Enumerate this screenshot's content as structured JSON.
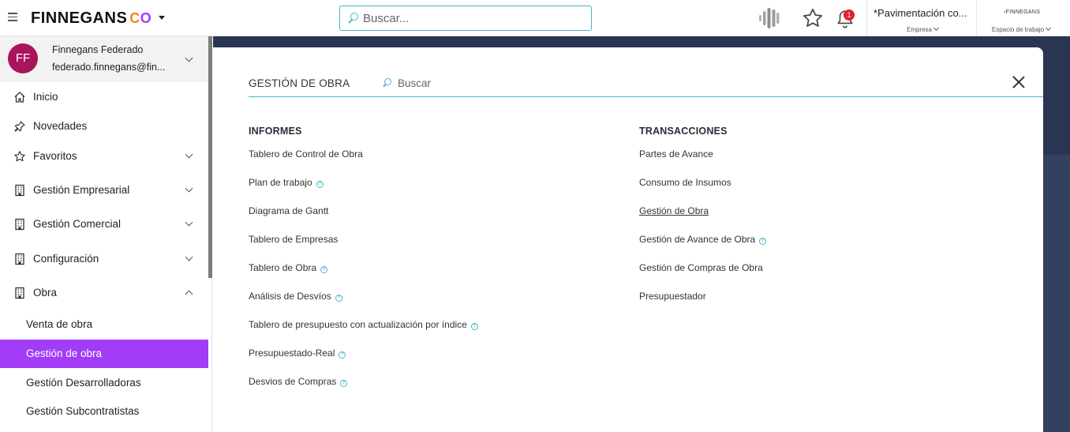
{
  "topbar": {
    "brand": "FINNEGANS",
    "brand_suffix_c": "C",
    "brand_suffix_o": "O",
    "search_placeholder": "Buscar...",
    "notification_count": "1",
    "company_name": "*Pavimentación co...",
    "company_label": "Empresa",
    "workspace_logo": "FINNEGANS",
    "workspace_label": "Espacio de trabajo"
  },
  "user": {
    "initials": "FF",
    "name": "Finnegans Federado",
    "email": "federado.finnegans@fin..."
  },
  "sidebar": {
    "items": [
      {
        "label": "Inicio",
        "icon": "home-icon"
      },
      {
        "label": "Novedades",
        "icon": "pin-icon"
      },
      {
        "label": "Favoritos",
        "icon": "star-icon"
      },
      {
        "label": "Gestión Empresarial",
        "icon": "building-icon"
      },
      {
        "label": "Gestión Comercial",
        "icon": "building-icon"
      },
      {
        "label": "Configuración",
        "icon": "building-icon"
      },
      {
        "label": "Obra",
        "icon": "building-icon"
      }
    ],
    "subitems": [
      {
        "label": "Venta de obra"
      },
      {
        "label": "Gestión de obra"
      },
      {
        "label": "Gestión Desarrolladoras"
      },
      {
        "label": "Gestión Subcontratistas"
      }
    ]
  },
  "panel": {
    "title": "GESTIÓN DE OBRA",
    "search_placeholder": "Buscar",
    "informes": {
      "heading": "INFORMES",
      "links": [
        {
          "label": "Tablero de Control de Obra"
        },
        {
          "label": "Plan de trabajo"
        },
        {
          "label": "Diagrama de Gantt"
        },
        {
          "label": "Tablero de Empresas"
        },
        {
          "label": "Tablero de Obra"
        },
        {
          "label": "Análisis de Desvíos"
        },
        {
          "label": "Tablero de presupuesto con actualización por índice"
        },
        {
          "label": "Presupuestado-Real"
        },
        {
          "label": "Desvios de Compras"
        }
      ]
    },
    "transacciones": {
      "heading": "TRANSACCIONES",
      "links": [
        {
          "label": "Partes de Avance"
        },
        {
          "label": "Consumo de Insumos"
        },
        {
          "label": "Gestión de Obra"
        },
        {
          "label": "Gestión de Avance de Obra"
        },
        {
          "label": "Gestión de Compras de Obra"
        },
        {
          "label": "Presupuestador"
        }
      ]
    },
    "help_glyph": "?"
  },
  "colors": {
    "accent_purple": "#a23cf7",
    "accent_teal": "#4fb3c8",
    "avatar": "#a8155a",
    "badge_red": "#e5202e",
    "background_navy": "#2a3551"
  }
}
